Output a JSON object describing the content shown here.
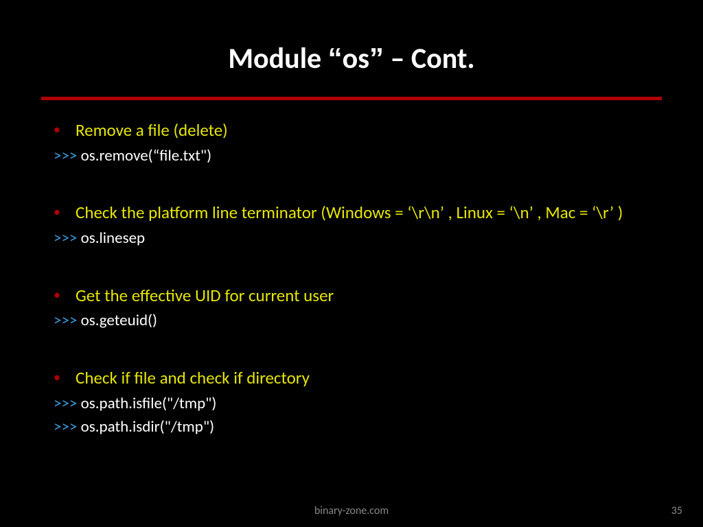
{
  "title_pre": "Module ",
  "title_lq": "“",
  "title_mid": "os",
  "title_rq": "”",
  "title_post": " – Cont.",
  "items": [
    {
      "bullet": "Remove a file (delete)",
      "codes": [
        {
          "prompt": ">>>",
          "text": " os.remove(“file.txt\")"
        }
      ]
    },
    {
      "bullet": "Check the platform line terminator (Windows = ‘\\r\\n’ , Linux = ‘\\n’ , Mac = ‘\\r’ )",
      "codes": [
        {
          "prompt": ">>>",
          "text": " os.linesep"
        }
      ]
    },
    {
      "bullet": "Get the effective UID for current user",
      "codes": [
        {
          "prompt": ">>>",
          "text": " os.geteuid()"
        }
      ]
    },
    {
      "bullet": "Check if file and check if directory",
      "codes": [
        {
          "prompt": ">>>",
          "text": " os.path.isfile(\"/tmp\")"
        },
        {
          "prompt": ">>>",
          "text": " os.path.isdir(\"/tmp\")"
        }
      ]
    }
  ],
  "footer_center": "binary-zone.com",
  "footer_right": "35"
}
